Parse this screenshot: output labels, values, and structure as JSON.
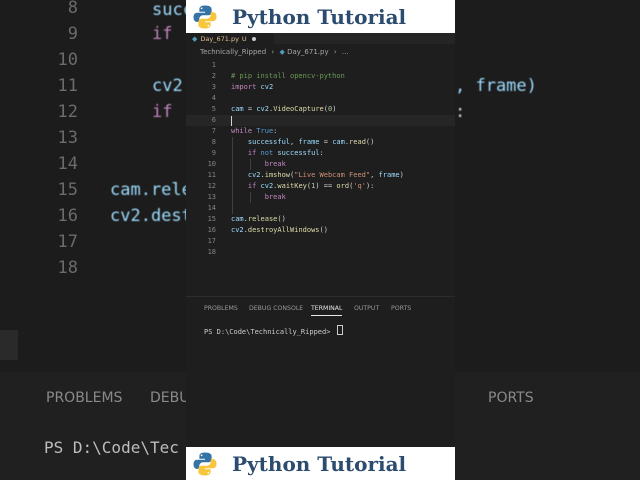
{
  "background": {
    "line_numbers": [
      "8",
      "9",
      "10",
      "11",
      "12",
      "13",
      "14",
      "15",
      "16",
      "17",
      "18"
    ],
    "code_fragments": [
      "succ",
      "if",
      "cv2",
      "if",
      "cam.rele",
      "cv2.destr",
      ", frame)",
      ":"
    ],
    "panel_tabs": [
      "PROBLEMS",
      "DEBU",
      "PORTS"
    ],
    "prompt": "PS D:\\Code\\Tec"
  },
  "banner": {
    "title": "Python Tutorial",
    "logo_icon": "python-logo-icon"
  },
  "tab": {
    "filename": "Day_671.py",
    "status": "U"
  },
  "breadcrumb": {
    "folder": "Technically_Ripped",
    "file": "Day_671.py",
    "more": "..."
  },
  "editor": {
    "lines": [
      {
        "n": "1",
        "tokens": []
      },
      {
        "n": "2",
        "tokens": [
          {
            "t": "# pip install opencv-python",
            "c": "c-com"
          }
        ]
      },
      {
        "n": "3",
        "tokens": [
          {
            "t": "import ",
            "c": "c-kw"
          },
          {
            "t": "cv2",
            "c": "c-var"
          }
        ]
      },
      {
        "n": "4",
        "tokens": []
      },
      {
        "n": "5",
        "tokens": [
          {
            "t": "cam",
            "c": "c-var"
          },
          {
            "t": " = ",
            "c": "c-op"
          },
          {
            "t": "cv2",
            "c": "c-var"
          },
          {
            "t": ".",
            "c": "c-op"
          },
          {
            "t": "VideoCapture",
            "c": "c-fn"
          },
          {
            "t": "(",
            "c": "c-op"
          },
          {
            "t": "0",
            "c": "c-num"
          },
          {
            "t": ")",
            "c": "c-op"
          }
        ]
      },
      {
        "n": "6",
        "tokens": []
      },
      {
        "n": "7",
        "tokens": [
          {
            "t": "while ",
            "c": "c-kw"
          },
          {
            "t": "True",
            "c": "c-blue"
          },
          {
            "t": ":",
            "c": "c-op"
          }
        ]
      },
      {
        "n": "8",
        "tokens": [
          {
            "t": "    successful",
            "c": "c-var"
          },
          {
            "t": ", ",
            "c": "c-op"
          },
          {
            "t": "frame",
            "c": "c-var"
          },
          {
            "t": " = ",
            "c": "c-op"
          },
          {
            "t": "cam",
            "c": "c-var"
          },
          {
            "t": ".",
            "c": "c-op"
          },
          {
            "t": "read",
            "c": "c-fn"
          },
          {
            "t": "()",
            "c": "c-op"
          }
        ]
      },
      {
        "n": "9",
        "tokens": [
          {
            "t": "    if ",
            "c": "c-kw"
          },
          {
            "t": "not ",
            "c": "c-blue"
          },
          {
            "t": "successful",
            "c": "c-var"
          },
          {
            "t": ":",
            "c": "c-op"
          }
        ]
      },
      {
        "n": "10",
        "tokens": [
          {
            "t": "        break",
            "c": "c-kw"
          }
        ]
      },
      {
        "n": "11",
        "tokens": [
          {
            "t": "    cv2",
            "c": "c-var"
          },
          {
            "t": ".",
            "c": "c-op"
          },
          {
            "t": "imshow",
            "c": "c-fn"
          },
          {
            "t": "(",
            "c": "c-op"
          },
          {
            "t": "\"Live Webcam Feed\"",
            "c": "c-str"
          },
          {
            "t": ", ",
            "c": "c-op"
          },
          {
            "t": "frame",
            "c": "c-var"
          },
          {
            "t": ")",
            "c": "c-op"
          }
        ]
      },
      {
        "n": "12",
        "tokens": [
          {
            "t": "    if ",
            "c": "c-kw"
          },
          {
            "t": "cv2",
            "c": "c-var"
          },
          {
            "t": ".",
            "c": "c-op"
          },
          {
            "t": "waitKey",
            "c": "c-fn"
          },
          {
            "t": "(",
            "c": "c-op"
          },
          {
            "t": "1",
            "c": "c-num"
          },
          {
            "t": ") == ",
            "c": "c-op"
          },
          {
            "t": "ord",
            "c": "c-fn"
          },
          {
            "t": "(",
            "c": "c-op"
          },
          {
            "t": "'q'",
            "c": "c-str"
          },
          {
            "t": "):",
            "c": "c-op"
          }
        ]
      },
      {
        "n": "13",
        "tokens": [
          {
            "t": "        break",
            "c": "c-kw"
          }
        ]
      },
      {
        "n": "14",
        "tokens": []
      },
      {
        "n": "15",
        "tokens": [
          {
            "t": "cam",
            "c": "c-var"
          },
          {
            "t": ".",
            "c": "c-op"
          },
          {
            "t": "release",
            "c": "c-fn"
          },
          {
            "t": "()",
            "c": "c-op"
          }
        ]
      },
      {
        "n": "16",
        "tokens": [
          {
            "t": "cv2",
            "c": "c-var"
          },
          {
            "t": ".",
            "c": "c-op"
          },
          {
            "t": "destroyAllWindows",
            "c": "c-fn"
          },
          {
            "t": "()",
            "c": "c-op"
          }
        ]
      },
      {
        "n": "17",
        "tokens": []
      },
      {
        "n": "18",
        "tokens": []
      }
    ],
    "current_line": "6"
  },
  "panel": {
    "tabs": [
      "PROBLEMS",
      "DEBUG CONSOLE",
      "TERMINAL",
      "OUTPUT",
      "PORTS"
    ],
    "active_tab": "TERMINAL",
    "prompt": "PS D:\\Code\\Technically_Ripped>"
  }
}
